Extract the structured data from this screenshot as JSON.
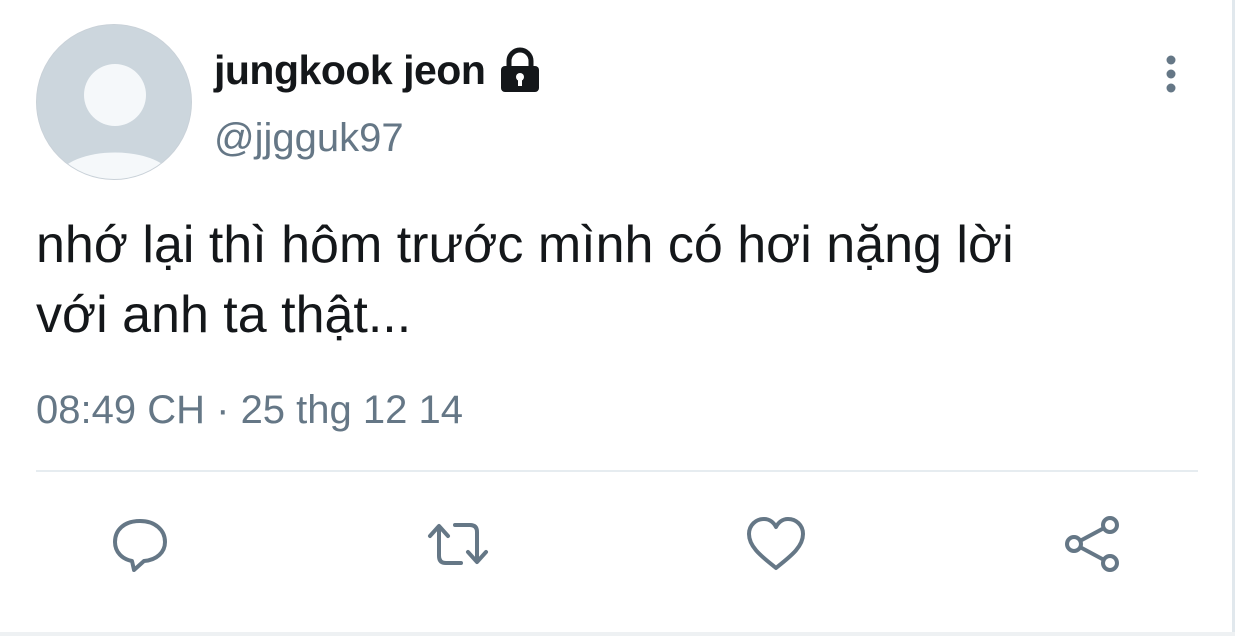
{
  "tweet": {
    "display_name": "jungkook jeon",
    "handle": "@jjgguk97",
    "text_line_1": "nhớ lại thì hôm trước mình có hơi nặng lời",
    "text_line_2": "với anh ta thật...",
    "time": "08:49 CH",
    "separator": "·",
    "date": "25 thg 12 14",
    "protected_icon": "lock-icon"
  },
  "actions": [
    {
      "name": "reply",
      "icon": "speech-bubble-icon"
    },
    {
      "name": "retweet",
      "icon": "retweet-arrows-icon"
    },
    {
      "name": "like",
      "icon": "heart-icon"
    },
    {
      "name": "share",
      "icon": "share-nodes-icon"
    }
  ],
  "colors": {
    "text": "#14171a",
    "secondary": "#657786",
    "divider": "#e6ecf0",
    "avatar_bg": "#ccd6dd",
    "avatar_figure": "#f5f8fa"
  }
}
